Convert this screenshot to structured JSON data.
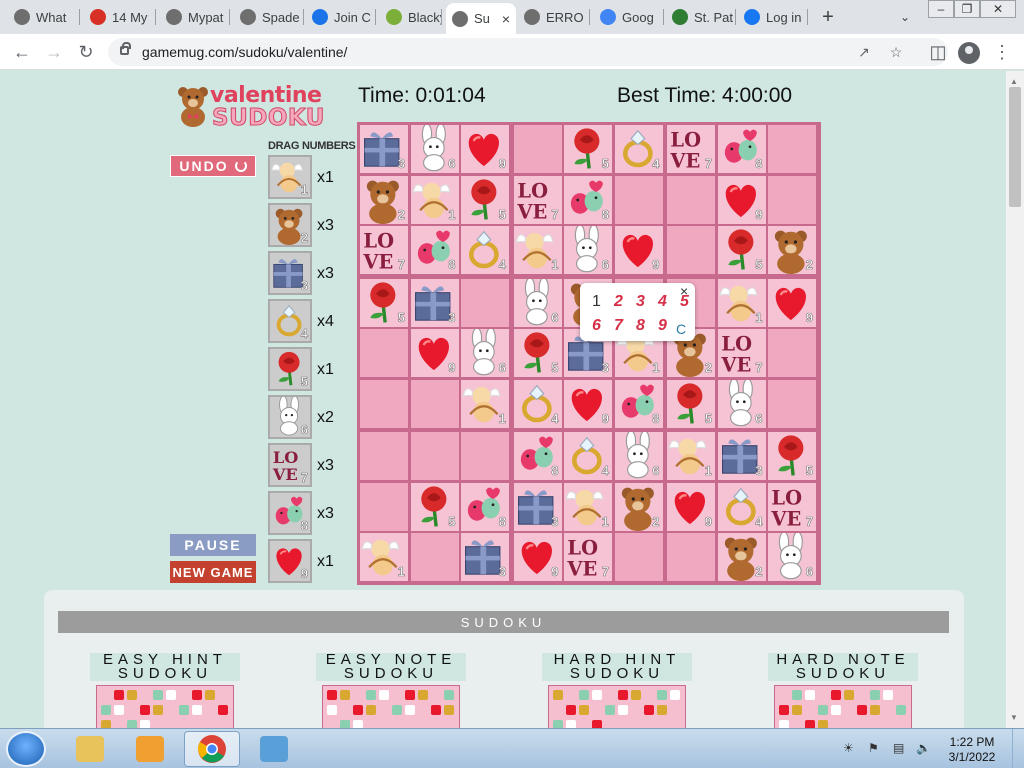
{
  "browser": {
    "tabs": [
      {
        "label": "What",
        "fav": "#6e6e6e",
        "icon": "chrome-icon"
      },
      {
        "label": "14 My",
        "fav": "#d93025",
        "icon": "site-icon"
      },
      {
        "label": "Mypat",
        "fav": "#6e6e6e",
        "icon": "globe-icon"
      },
      {
        "label": "Spade",
        "fav": "#6e6e6e",
        "icon": "globe-icon"
      },
      {
        "label": "Join C",
        "fav": "#1a73e8",
        "icon": "s-icon"
      },
      {
        "label": "Blacky",
        "fav": "#7cae3a",
        "icon": "game-icon"
      },
      {
        "label": "Su",
        "fav": "#6e6e6e",
        "icon": "globe-icon"
      },
      {
        "label": "ERRO",
        "fav": "#6e6e6e",
        "icon": "globe-icon"
      },
      {
        "label": "Goog",
        "fav": "#4285f4",
        "icon": "google-icon"
      },
      {
        "label": "St. Pat",
        "fav": "#2e7d32",
        "icon": "game-icon"
      },
      {
        "label": "Log in",
        "fav": "#1877f2",
        "icon": "facebook-icon"
      }
    ],
    "active_tab_close": "×",
    "new_tab": "+",
    "url": "gamemug.com/sudoku/valentine/"
  },
  "game": {
    "logo_top": "valentine",
    "logo_bottom": "SUDOKU",
    "time_label": "Time: 0:01:04",
    "best_time_label": "Best Time: 4:00:00",
    "drag_title": "DRAG NUMBERS",
    "undo_label": "UNDO",
    "pause_label": "PAUSE",
    "newgame_label": "NEW GAME",
    "counts": [
      "x1",
      "x3",
      "x3",
      "x4",
      "x1",
      "x2",
      "x3",
      "x3",
      "x1"
    ],
    "grid": [
      [
        3,
        6,
        9,
        0,
        5,
        4,
        7,
        8,
        0
      ],
      [
        2,
        1,
        5,
        7,
        8,
        0,
        0,
        9,
        0
      ],
      [
        7,
        8,
        4,
        1,
        6,
        9,
        0,
        5,
        2
      ],
      [
        5,
        3,
        0,
        6,
        2,
        0,
        0,
        1,
        9
      ],
      [
        0,
        9,
        6,
        5,
        3,
        1,
        2,
        7,
        0
      ],
      [
        0,
        0,
        1,
        4,
        9,
        8,
        5,
        6,
        0
      ],
      [
        0,
        0,
        0,
        8,
        4,
        6,
        1,
        3,
        5
      ],
      [
        0,
        5,
        8,
        3,
        1,
        2,
        9,
        4,
        7
      ],
      [
        1,
        0,
        3,
        9,
        7,
        0,
        0,
        2,
        6
      ]
    ],
    "popup": {
      "numbers": [
        "1",
        "2",
        "3",
        "4",
        "5",
        "6",
        "7",
        "8",
        "9"
      ],
      "clear": "C",
      "close": "×"
    }
  },
  "section": {
    "title": "SUDOKU",
    "cards": [
      {
        "line1": "EASY HINT",
        "line2": "SUDOKU"
      },
      {
        "line1": "EASY NOTE",
        "line2": "SUDOKU"
      },
      {
        "line1": "HARD HINT",
        "line2": "SUDOKU"
      },
      {
        "line1": "HARD NOTE",
        "line2": "SUDOKU"
      }
    ]
  },
  "taskbar": {
    "time": "1:22 PM",
    "date": "3/1/2022"
  }
}
